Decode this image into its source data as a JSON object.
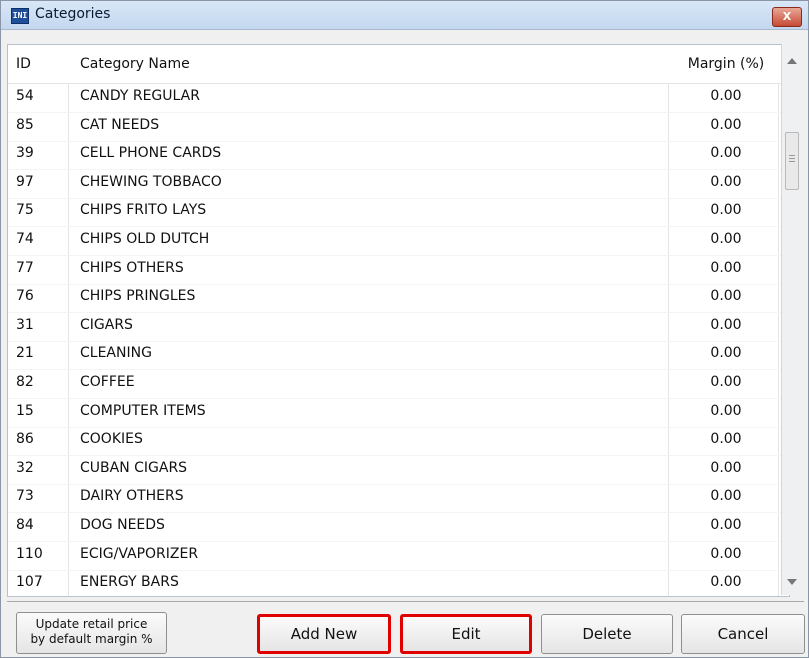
{
  "window": {
    "title": "Categories",
    "app_icon_text": "INI",
    "close_label": "X"
  },
  "table": {
    "headers": {
      "id": "ID",
      "name": "Category Name",
      "margin": "Margin (%)"
    },
    "rows": [
      {
        "id": "54",
        "name": "CANDY REGULAR",
        "margin": "0.00"
      },
      {
        "id": "85",
        "name": "CAT NEEDS",
        "margin": "0.00"
      },
      {
        "id": "39",
        "name": "CELL PHONE CARDS",
        "margin": "0.00"
      },
      {
        "id": "97",
        "name": "CHEWING TOBBACO",
        "margin": "0.00"
      },
      {
        "id": "75",
        "name": "CHIPS FRITO LAYS",
        "margin": "0.00"
      },
      {
        "id": "74",
        "name": "CHIPS OLD DUTCH",
        "margin": "0.00"
      },
      {
        "id": "77",
        "name": "CHIPS OTHERS",
        "margin": "0.00"
      },
      {
        "id": "76",
        "name": "CHIPS PRINGLES",
        "margin": "0.00"
      },
      {
        "id": "31",
        "name": "CIGARS",
        "margin": "0.00"
      },
      {
        "id": "21",
        "name": "CLEANING",
        "margin": "0.00"
      },
      {
        "id": "82",
        "name": "COFFEE",
        "margin": "0.00"
      },
      {
        "id": "15",
        "name": "COMPUTER ITEMS",
        "margin": "0.00"
      },
      {
        "id": "86",
        "name": "COOKIES",
        "margin": "0.00"
      },
      {
        "id": "32",
        "name": "CUBAN CIGARS",
        "margin": "0.00"
      },
      {
        "id": "73",
        "name": "DAIRY OTHERS",
        "margin": "0.00"
      },
      {
        "id": "84",
        "name": "DOG NEEDS",
        "margin": "0.00"
      },
      {
        "id": "110",
        "name": "ECIG/VAPORIZER",
        "margin": "0.00"
      },
      {
        "id": "107",
        "name": "ENERGY BARS",
        "margin": "0.00"
      }
    ]
  },
  "buttons": {
    "update_line1": "Update retail price",
    "update_line2": "by default margin %",
    "add_new": "Add New",
    "edit": "Edit",
    "delete": "Delete",
    "cancel": "Cancel"
  },
  "colors": {
    "highlight_border": "#e00000",
    "title_gradient": "#c3d7ef"
  }
}
